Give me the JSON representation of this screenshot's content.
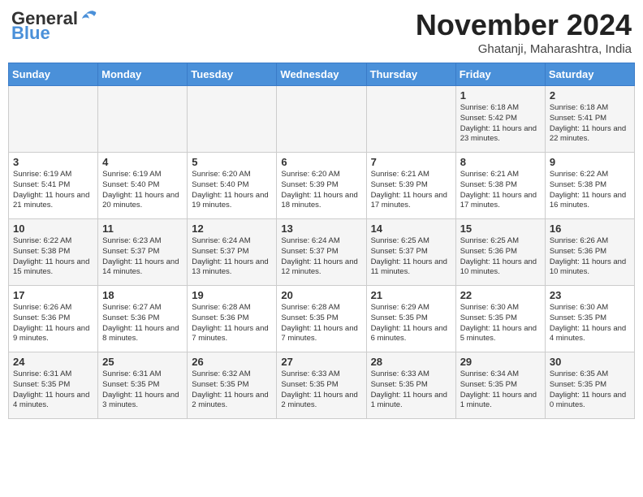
{
  "header": {
    "logo_line1": "General",
    "logo_line2": "Blue",
    "month_title": "November 2024",
    "location": "Ghatanji, Maharashtra, India"
  },
  "weekdays": [
    "Sunday",
    "Monday",
    "Tuesday",
    "Wednesday",
    "Thursday",
    "Friday",
    "Saturday"
  ],
  "weeks": [
    [
      {
        "day": "",
        "info": ""
      },
      {
        "day": "",
        "info": ""
      },
      {
        "day": "",
        "info": ""
      },
      {
        "day": "",
        "info": ""
      },
      {
        "day": "",
        "info": ""
      },
      {
        "day": "1",
        "info": "Sunrise: 6:18 AM\nSunset: 5:42 PM\nDaylight: 11 hours and 23 minutes."
      },
      {
        "day": "2",
        "info": "Sunrise: 6:18 AM\nSunset: 5:41 PM\nDaylight: 11 hours and 22 minutes."
      }
    ],
    [
      {
        "day": "3",
        "info": "Sunrise: 6:19 AM\nSunset: 5:41 PM\nDaylight: 11 hours and 21 minutes."
      },
      {
        "day": "4",
        "info": "Sunrise: 6:19 AM\nSunset: 5:40 PM\nDaylight: 11 hours and 20 minutes."
      },
      {
        "day": "5",
        "info": "Sunrise: 6:20 AM\nSunset: 5:40 PM\nDaylight: 11 hours and 19 minutes."
      },
      {
        "day": "6",
        "info": "Sunrise: 6:20 AM\nSunset: 5:39 PM\nDaylight: 11 hours and 18 minutes."
      },
      {
        "day": "7",
        "info": "Sunrise: 6:21 AM\nSunset: 5:39 PM\nDaylight: 11 hours and 17 minutes."
      },
      {
        "day": "8",
        "info": "Sunrise: 6:21 AM\nSunset: 5:38 PM\nDaylight: 11 hours and 17 minutes."
      },
      {
        "day": "9",
        "info": "Sunrise: 6:22 AM\nSunset: 5:38 PM\nDaylight: 11 hours and 16 minutes."
      }
    ],
    [
      {
        "day": "10",
        "info": "Sunrise: 6:22 AM\nSunset: 5:38 PM\nDaylight: 11 hours and 15 minutes."
      },
      {
        "day": "11",
        "info": "Sunrise: 6:23 AM\nSunset: 5:37 PM\nDaylight: 11 hours and 14 minutes."
      },
      {
        "day": "12",
        "info": "Sunrise: 6:24 AM\nSunset: 5:37 PM\nDaylight: 11 hours and 13 minutes."
      },
      {
        "day": "13",
        "info": "Sunrise: 6:24 AM\nSunset: 5:37 PM\nDaylight: 11 hours and 12 minutes."
      },
      {
        "day": "14",
        "info": "Sunrise: 6:25 AM\nSunset: 5:37 PM\nDaylight: 11 hours and 11 minutes."
      },
      {
        "day": "15",
        "info": "Sunrise: 6:25 AM\nSunset: 5:36 PM\nDaylight: 11 hours and 10 minutes."
      },
      {
        "day": "16",
        "info": "Sunrise: 6:26 AM\nSunset: 5:36 PM\nDaylight: 11 hours and 10 minutes."
      }
    ],
    [
      {
        "day": "17",
        "info": "Sunrise: 6:26 AM\nSunset: 5:36 PM\nDaylight: 11 hours and 9 minutes."
      },
      {
        "day": "18",
        "info": "Sunrise: 6:27 AM\nSunset: 5:36 PM\nDaylight: 11 hours and 8 minutes."
      },
      {
        "day": "19",
        "info": "Sunrise: 6:28 AM\nSunset: 5:36 PM\nDaylight: 11 hours and 7 minutes."
      },
      {
        "day": "20",
        "info": "Sunrise: 6:28 AM\nSunset: 5:35 PM\nDaylight: 11 hours and 7 minutes."
      },
      {
        "day": "21",
        "info": "Sunrise: 6:29 AM\nSunset: 5:35 PM\nDaylight: 11 hours and 6 minutes."
      },
      {
        "day": "22",
        "info": "Sunrise: 6:30 AM\nSunset: 5:35 PM\nDaylight: 11 hours and 5 minutes."
      },
      {
        "day": "23",
        "info": "Sunrise: 6:30 AM\nSunset: 5:35 PM\nDaylight: 11 hours and 4 minutes."
      }
    ],
    [
      {
        "day": "24",
        "info": "Sunrise: 6:31 AM\nSunset: 5:35 PM\nDaylight: 11 hours and 4 minutes."
      },
      {
        "day": "25",
        "info": "Sunrise: 6:31 AM\nSunset: 5:35 PM\nDaylight: 11 hours and 3 minutes."
      },
      {
        "day": "26",
        "info": "Sunrise: 6:32 AM\nSunset: 5:35 PM\nDaylight: 11 hours and 2 minutes."
      },
      {
        "day": "27",
        "info": "Sunrise: 6:33 AM\nSunset: 5:35 PM\nDaylight: 11 hours and 2 minutes."
      },
      {
        "day": "28",
        "info": "Sunrise: 6:33 AM\nSunset: 5:35 PM\nDaylight: 11 hours and 1 minute."
      },
      {
        "day": "29",
        "info": "Sunrise: 6:34 AM\nSunset: 5:35 PM\nDaylight: 11 hours and 1 minute."
      },
      {
        "day": "30",
        "info": "Sunrise: 6:35 AM\nSunset: 5:35 PM\nDaylight: 11 hours and 0 minutes."
      }
    ]
  ]
}
